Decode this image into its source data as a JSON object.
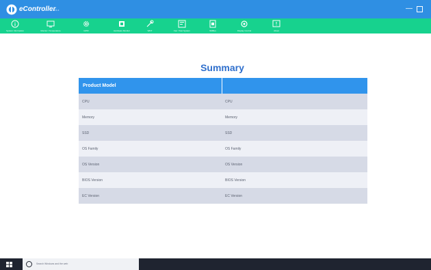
{
  "window": {
    "title": "eController",
    "version": "v1.x",
    "minimize_glyph": "—"
  },
  "toolbar": {
    "items": [
      {
        "label": "System Information",
        "icon": "info-icon"
      },
      {
        "label": "Monitor / Temperature",
        "icon": "monitor-icon"
      },
      {
        "label": "GPIO",
        "icon": "gear-icon"
      },
      {
        "label": "Hardware Monitor",
        "icon": "chip-icon"
      },
      {
        "label": "WDT",
        "icon": "tools-icon"
      },
      {
        "label": "Fan / Test System",
        "icon": "display-icon"
      },
      {
        "label": "SMBus",
        "icon": "sd-card-icon"
      },
      {
        "label": "Display Control",
        "icon": "settings-icon"
      },
      {
        "label": "About",
        "icon": "message-icon"
      }
    ],
    "bg_color": "#17d28e"
  },
  "summary": {
    "title": "Summary",
    "header": {
      "col1": "Product Model",
      "col2": ""
    },
    "rows": [
      {
        "label": "CPU",
        "value": "CPU"
      },
      {
        "label": "Memory",
        "value": "Memory"
      },
      {
        "label": "SSD",
        "value": "SSD"
      },
      {
        "label": "OS Family",
        "value": "OS Family"
      },
      {
        "label": "OS Version",
        "value": "OS Version"
      },
      {
        "label": "BIOS Version",
        "value": "BIOS Version"
      },
      {
        "label": "EC Version",
        "value": "EC Version"
      }
    ]
  },
  "taskbar": {
    "search_placeholder": "Search Windows and the web"
  },
  "colors": {
    "titlebar": "#2f8fe3",
    "accent": "#3094ec",
    "title_text": "#2f6fcc"
  }
}
